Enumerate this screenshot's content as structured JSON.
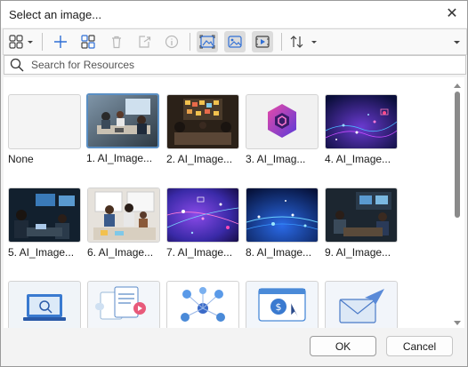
{
  "dialog": {
    "title": "Select an image...",
    "close_glyph": "✕"
  },
  "toolbar": {
    "buttons": [
      {
        "name": "view-mode-icon",
        "pressed": false
      },
      {
        "name": "add-icon",
        "pressed": false
      },
      {
        "name": "group-icon",
        "pressed": false
      },
      {
        "name": "delete-icon",
        "pressed": false
      },
      {
        "name": "export-icon",
        "pressed": false
      },
      {
        "name": "info-icon",
        "pressed": false
      },
      {
        "name": "image-fit-icon",
        "pressed": true
      },
      {
        "name": "image-icon",
        "pressed": true
      },
      {
        "name": "video-icon",
        "pressed": true
      },
      {
        "name": "sort-icon",
        "pressed": false
      },
      {
        "name": "more-options-icon",
        "pressed": false
      }
    ]
  },
  "search": {
    "placeholder": "Search for Resources",
    "value": ""
  },
  "gallery": {
    "items": [
      {
        "label": "None",
        "kind": "none",
        "selected": false
      },
      {
        "label": "1. AI_Image...",
        "kind": "office-meeting",
        "selected": true
      },
      {
        "label": "2. AI_Image...",
        "kind": "team-board",
        "selected": false
      },
      {
        "label": "3. AI_Imag...",
        "kind": "hexagon-logo",
        "selected": false
      },
      {
        "label": "4. AI_Image...",
        "kind": "digital-network",
        "selected": false
      },
      {
        "label": "5. AI_Image...",
        "kind": "dark-office",
        "selected": false
      },
      {
        "label": "6. AI_Image...",
        "kind": "whiteboard-team",
        "selected": false
      },
      {
        "label": "7. AI_Image...",
        "kind": "purple-network",
        "selected": false
      },
      {
        "label": "8. AI_Image...",
        "kind": "blue-network",
        "selected": false
      },
      {
        "label": "9. AI_Image...",
        "kind": "conference-room",
        "selected": false
      },
      {
        "label": "",
        "kind": "laptop-search-illustration",
        "selected": false
      },
      {
        "label": "",
        "kind": "documents-illustration",
        "selected": false
      },
      {
        "label": "",
        "kind": "people-network-illustration",
        "selected": false
      },
      {
        "label": "",
        "kind": "payment-illustration",
        "selected": false
      },
      {
        "label": "",
        "kind": "email-illustration",
        "selected": false
      }
    ]
  },
  "footer": {
    "ok_label": "OK",
    "cancel_label": "Cancel"
  },
  "colors": {
    "selection_border": "#5a8fc4",
    "accent_blue": "#2f6fd6"
  }
}
